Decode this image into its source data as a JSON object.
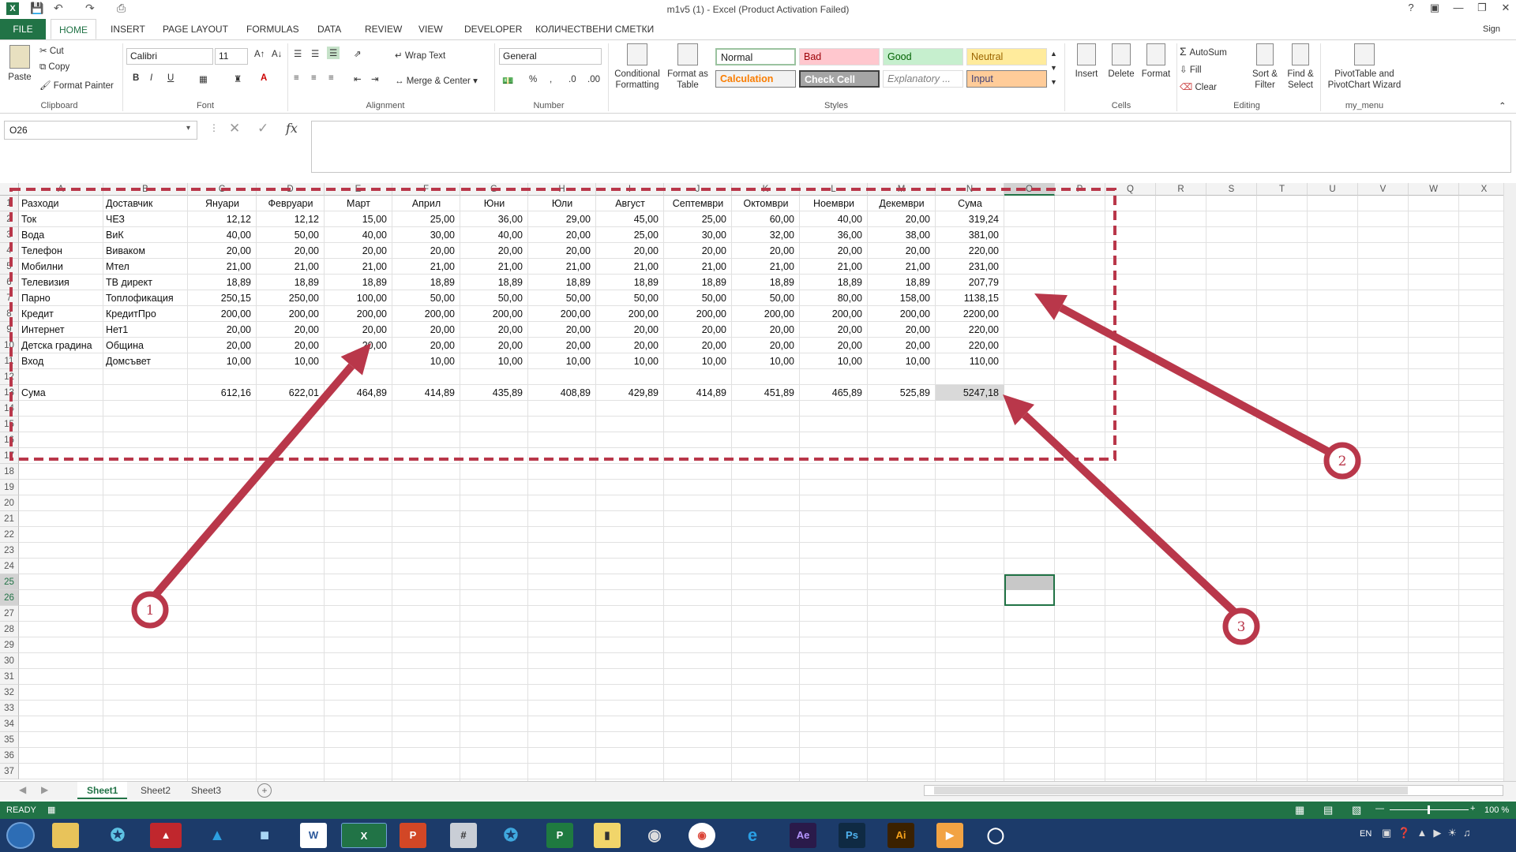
{
  "window": {
    "title": "m1v5 (1) - Excel (Product Activation Failed)",
    "sign_in": "Sign in"
  },
  "tabs": [
    "FILE",
    "HOME",
    "INSERT",
    "PAGE LAYOUT",
    "FORMULAS",
    "DATA",
    "REVIEW",
    "VIEW",
    "DEVELOPER",
    "КОЛИЧЕСТВЕНИ СМЕТКИ"
  ],
  "ribbon": {
    "clipboard": {
      "paste": "Paste",
      "cut": "Cut",
      "copy": "Copy",
      "format_painter": "Format Painter",
      "label": "Clipboard"
    },
    "font": {
      "name": "Calibri",
      "size": "11",
      "label": "Font"
    },
    "alignment": {
      "wrap": "Wrap Text",
      "merge": "Merge & Center",
      "label": "Alignment"
    },
    "number": {
      "format": "General",
      "label": "Number"
    },
    "styles": {
      "conditional": "Conditional Formatting",
      "format_table": "Format as Table",
      "normal": "Normal",
      "bad": "Bad",
      "good": "Good",
      "neutral": "Neutral",
      "calculation": "Calculation",
      "check": "Check Cell",
      "explanatory": "Explanatory ...",
      "input": "Input",
      "label": "Styles"
    },
    "cells": {
      "insert": "Insert",
      "delete": "Delete",
      "format": "Format",
      "label": "Cells"
    },
    "editing": {
      "autosum": "AutoSum",
      "fill": "Fill",
      "clear": "Clear",
      "sort": "Sort & Filter",
      "find": "Find & Select",
      "label": "Editing"
    },
    "my_menu": {
      "pivot": "PivotTable and PivotChart Wizard",
      "label": "my_menu"
    }
  },
  "namebox": "O26",
  "columns": [
    "A",
    "B",
    "C",
    "D",
    "E",
    "F",
    "G",
    "H",
    "I",
    "J",
    "K",
    "L",
    "M",
    "N",
    "O",
    "P",
    "Q",
    "R",
    "S",
    "T",
    "U",
    "V",
    "W",
    "X"
  ],
  "row_numbers": [
    "1",
    "2",
    "3",
    "4",
    "5",
    "6",
    "7",
    "8",
    "9",
    "10",
    "11",
    "12",
    "13",
    "14",
    "15",
    "16",
    "17",
    "18",
    "19",
    "20",
    "21",
    "22",
    "23",
    "24",
    "25",
    "26",
    "27",
    "28",
    "29",
    "30",
    "31",
    "32",
    "33",
    "34",
    "35",
    "36",
    "37"
  ],
  "table": {
    "header": [
      "Разходи",
      "Доставчик",
      "Януари",
      "Февруари",
      "Март",
      "Април",
      "Юни",
      "Юли",
      "Август",
      "Септември",
      "Октомври",
      "Ноември",
      "Декември",
      "Сума"
    ],
    "rows": [
      [
        "Ток",
        "ЧЕЗ",
        "12,12",
        "12,12",
        "15,00",
        "25,00",
        "36,00",
        "29,00",
        "45,00",
        "25,00",
        "60,00",
        "40,00",
        "20,00",
        "319,24"
      ],
      [
        "Вода",
        "ВиК",
        "40,00",
        "50,00",
        "40,00",
        "30,00",
        "40,00",
        "20,00",
        "25,00",
        "30,00",
        "32,00",
        "36,00",
        "38,00",
        "381,00"
      ],
      [
        "Телефон",
        "Виваком",
        "20,00",
        "20,00",
        "20,00",
        "20,00",
        "20,00",
        "20,00",
        "20,00",
        "20,00",
        "20,00",
        "20,00",
        "20,00",
        "220,00"
      ],
      [
        "Мобилни",
        "Мтел",
        "21,00",
        "21,00",
        "21,00",
        "21,00",
        "21,00",
        "21,00",
        "21,00",
        "21,00",
        "21,00",
        "21,00",
        "21,00",
        "231,00"
      ],
      [
        "Телевизия",
        "ТВ директ",
        "18,89",
        "18,89",
        "18,89",
        "18,89",
        "18,89",
        "18,89",
        "18,89",
        "18,89",
        "18,89",
        "18,89",
        "18,89",
        "207,79"
      ],
      [
        "Парно",
        "Топлофикация",
        "250,15",
        "250,00",
        "100,00",
        "50,00",
        "50,00",
        "50,00",
        "50,00",
        "50,00",
        "50,00",
        "80,00",
        "158,00",
        "1138,15"
      ],
      [
        "Кредит",
        "КредитПро",
        "200,00",
        "200,00",
        "200,00",
        "200,00",
        "200,00",
        "200,00",
        "200,00",
        "200,00",
        "200,00",
        "200,00",
        "200,00",
        "2200,00"
      ],
      [
        "Интернет",
        "Нет1",
        "20,00",
        "20,00",
        "20,00",
        "20,00",
        "20,00",
        "20,00",
        "20,00",
        "20,00",
        "20,00",
        "20,00",
        "20,00",
        "220,00"
      ],
      [
        "Детска градина",
        "Община",
        "20,00",
        "20,00",
        "20,00",
        "20,00",
        "20,00",
        "20,00",
        "20,00",
        "20,00",
        "20,00",
        "20,00",
        "20,00",
        "220,00"
      ],
      [
        "Вход",
        "Домсъвет",
        "10,00",
        "10,00",
        "",
        "10,00",
        "10,00",
        "10,00",
        "10,00",
        "10,00",
        "10,00",
        "10,00",
        "10,00",
        "110,00"
      ]
    ],
    "total": [
      "Сума",
      "",
      "612,16",
      "622,01",
      "464,89",
      "414,89",
      "435,89",
      "408,89",
      "429,89",
      "414,89",
      "451,89",
      "465,89",
      "525,89",
      "5247,18"
    ]
  },
  "annotations": [
    "1",
    "2",
    "3"
  ],
  "sheets": [
    "Sheet1",
    "Sheet2",
    "Sheet3"
  ],
  "status": {
    "ready": "READY",
    "zoom": "100 %",
    "lang": "EN"
  },
  "taskbar_apps": [
    "W",
    "P",
    "Ae",
    "Ps",
    "Ai"
  ]
}
